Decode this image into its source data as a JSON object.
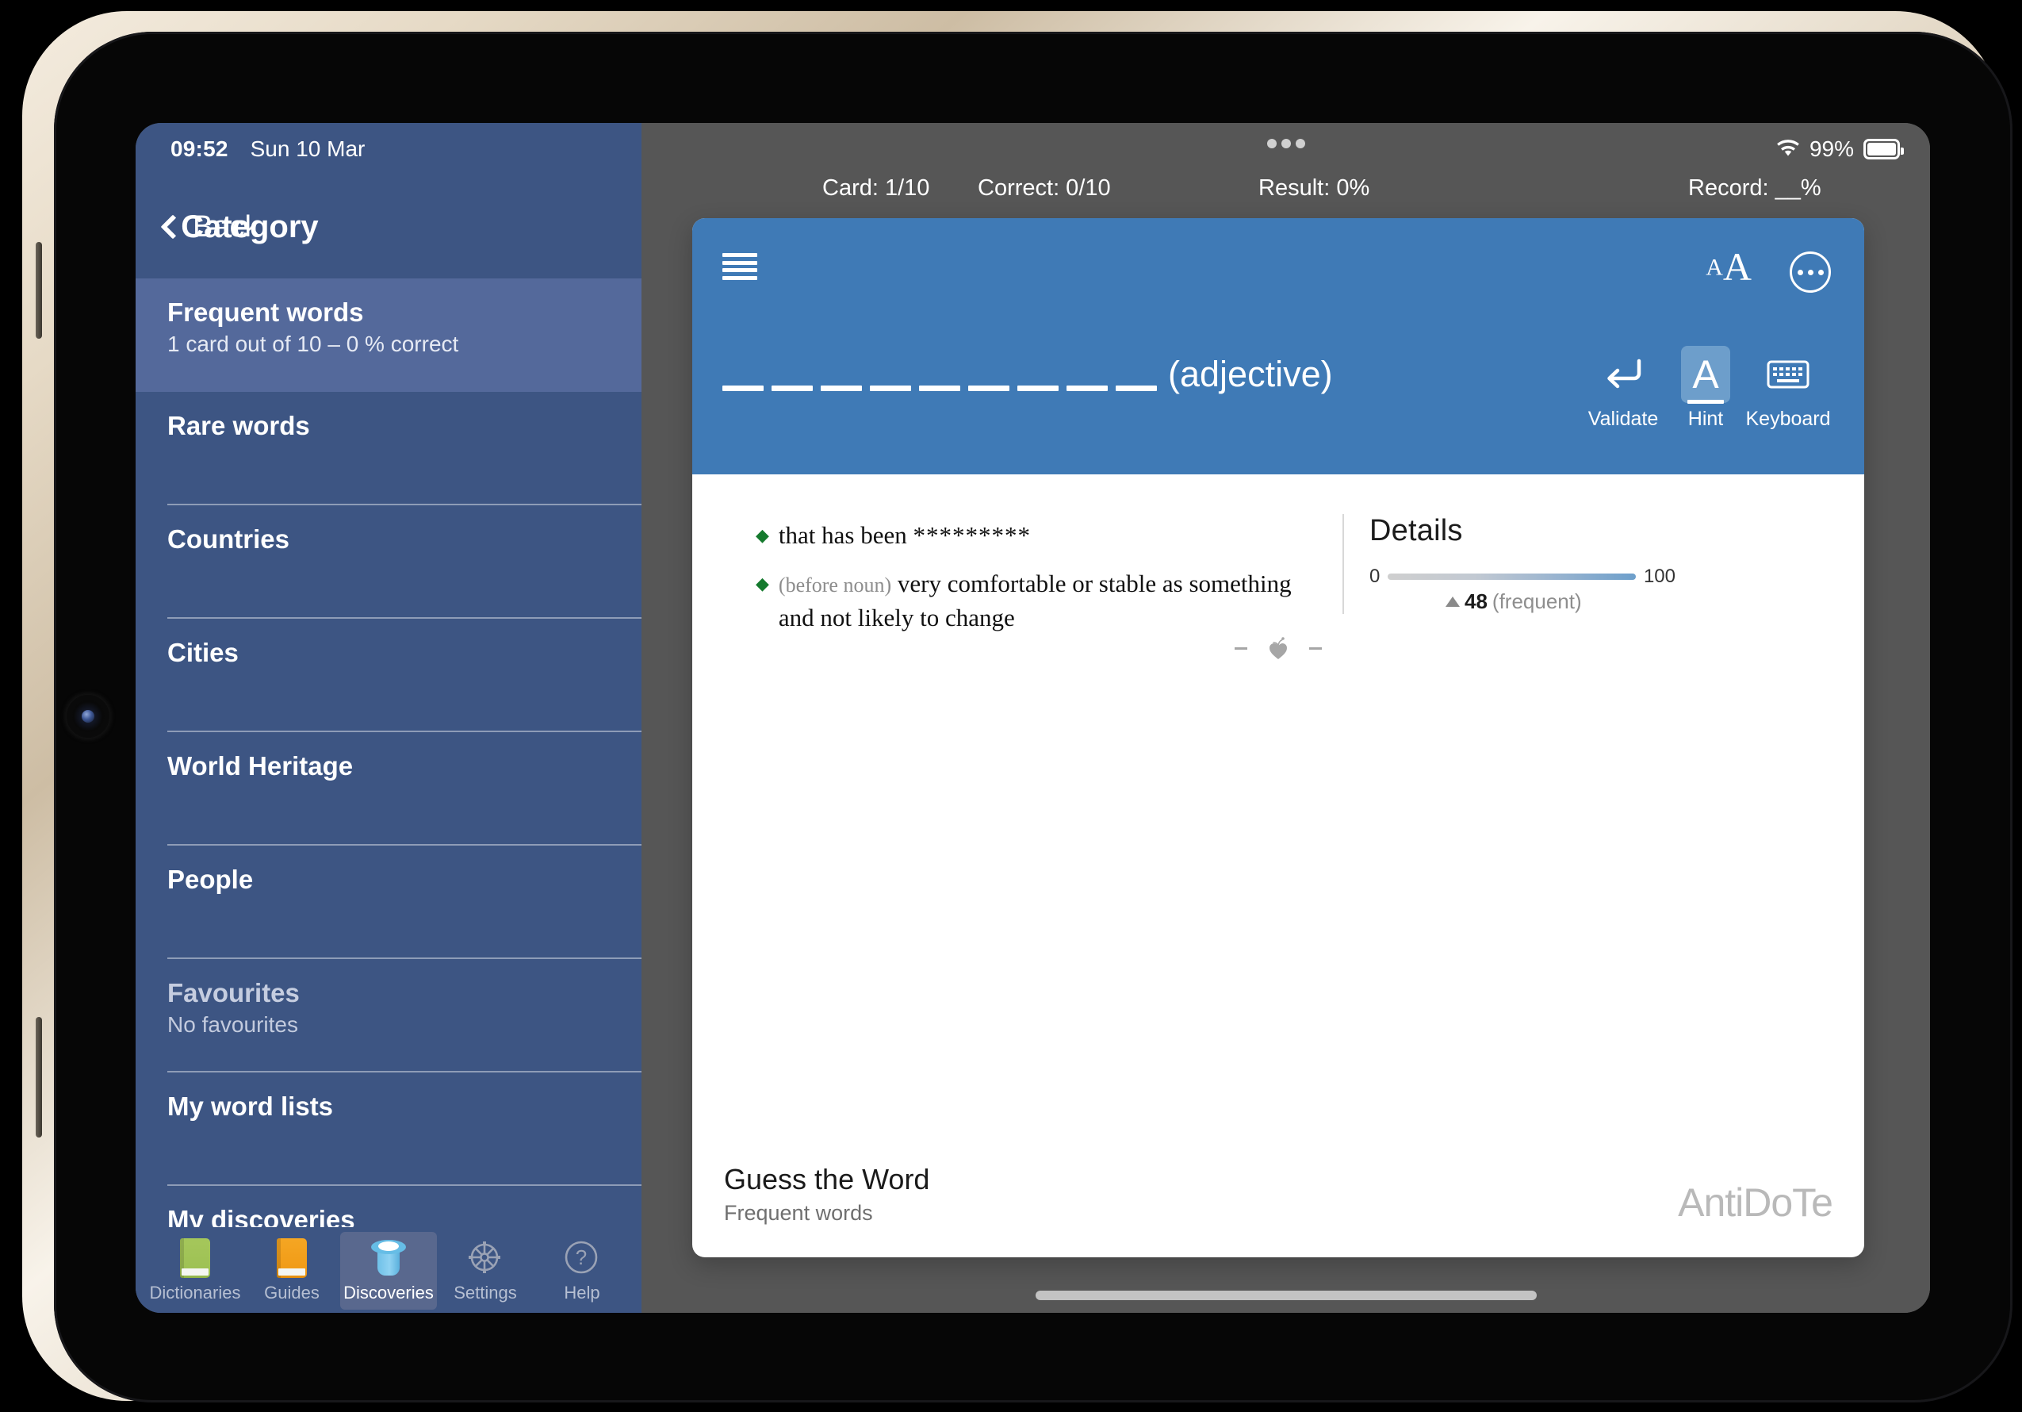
{
  "ios_status": {
    "time": "09:52",
    "date": "Sun 10 Mar"
  },
  "sidebar": {
    "back_label": "Back",
    "title": "Category",
    "items": [
      {
        "title": "Frequent words",
        "sub": "1 card out of 10 – 0 % correct",
        "selected": true,
        "dim": false
      },
      {
        "title": "Rare words",
        "sub": "",
        "selected": false,
        "dim": false
      },
      {
        "title": "Countries",
        "sub": "",
        "selected": false,
        "dim": false
      },
      {
        "title": "Cities",
        "sub": "",
        "selected": false,
        "dim": false
      },
      {
        "title": "World Heritage",
        "sub": "",
        "selected": false,
        "dim": false
      },
      {
        "title": "People",
        "sub": "",
        "selected": false,
        "dim": false
      },
      {
        "title": "Favourites",
        "sub": "No favourites",
        "selected": false,
        "dim": true
      },
      {
        "title": "My word lists",
        "sub": "",
        "selected": false,
        "dim": false
      },
      {
        "title": "My discoveries",
        "sub": "",
        "selected": false,
        "dim": false
      }
    ]
  },
  "tab_bar": {
    "tabs": [
      {
        "label": "Dictionaries",
        "icon": "green-book-icon",
        "active": false
      },
      {
        "label": "Guides",
        "icon": "orange-book-icon",
        "active": false
      },
      {
        "label": "Discoveries",
        "icon": "top-hat-icon",
        "active": true
      },
      {
        "label": "Settings",
        "icon": "gear-icon",
        "active": false
      },
      {
        "label": "Help",
        "icon": "question-circle-icon",
        "active": false
      }
    ]
  },
  "main_status": {
    "battery_percent": "99%",
    "score": {
      "card": "Card: 1/10",
      "correct": "Correct: 0/10",
      "result": "Result: 0%",
      "record": "Record: __%"
    }
  },
  "card": {
    "header": {
      "blank_count": 9,
      "part_of_speech": "(adjective)",
      "tools": [
        {
          "label": "Validate",
          "icon": "enter-return-icon",
          "active": false
        },
        {
          "label": "Hint",
          "icon": "letter-a-icon",
          "active": true
        },
        {
          "label": "Keyboard",
          "icon": "keyboard-icon",
          "active": false
        }
      ]
    },
    "definitions": [
      {
        "prefix": "",
        "text": "that has been",
        "stars": "*********"
      },
      {
        "prefix": "(before noun)",
        "text": "very comfortable or stable as something and not likely to change",
        "stars": ""
      }
    ],
    "details": {
      "title": "Details",
      "min": "0",
      "max": "100",
      "value": "48",
      "note": "(frequent)"
    },
    "footer": {
      "title": "Guess the Word",
      "subtitle": "Frequent words",
      "logo": "AntiDoTe"
    }
  },
  "colors": {
    "sidebar_bg": "#3d5583",
    "sidebar_selected": "#54699b",
    "card_header_blue": "#3f7ab6",
    "hint_active": "#6d9ecb",
    "bullet_green": "#157a2e",
    "main_bg": "#565656"
  }
}
